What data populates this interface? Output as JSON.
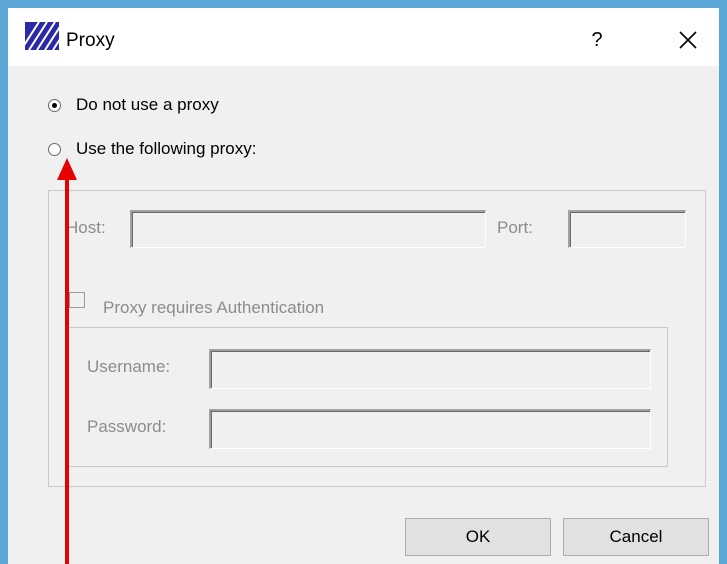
{
  "window": {
    "title": "Proxy",
    "help_label": "?",
    "close_label": "✕"
  },
  "options": {
    "no_proxy_label": "Do not use a proxy",
    "use_proxy_label": "Use the following proxy:",
    "selected": "no_proxy"
  },
  "proxy": {
    "host_label": "Host:",
    "host_value": "",
    "port_label": "Port:",
    "port_value": "",
    "auth_label": "Proxy requires Authentication",
    "auth_checked": false,
    "username_label": "Username:",
    "username_value": "",
    "password_label": "Password:",
    "password_value": ""
  },
  "buttons": {
    "ok_label": "OK",
    "cancel_label": "Cancel"
  },
  "colors": {
    "window_border": "#5aa6d6",
    "annotation_arrow": "#e60000"
  }
}
